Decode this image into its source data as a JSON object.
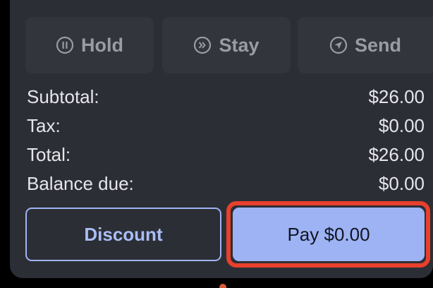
{
  "actions": {
    "hold_label": "Hold",
    "stay_label": "Stay",
    "send_label": "Send"
  },
  "totals": [
    {
      "label": "Subtotal:",
      "value": "$26.00"
    },
    {
      "label": "Tax:",
      "value": "$0.00"
    },
    {
      "label": "Total:",
      "value": "$26.00"
    },
    {
      "label": "Balance due:",
      "value": "$0.00"
    }
  ],
  "buttons": {
    "discount_label": "Discount",
    "pay_label": "Pay $0.00"
  },
  "colors": {
    "panel_bg": "#2c2e35",
    "action_bg": "#33353c",
    "accent": "#9db3f4",
    "highlight": "#e8402c"
  },
  "icons": {
    "hold": "pause-circle-icon",
    "stay": "fast-forward-circle-icon",
    "send": "send-navigation-icon"
  }
}
